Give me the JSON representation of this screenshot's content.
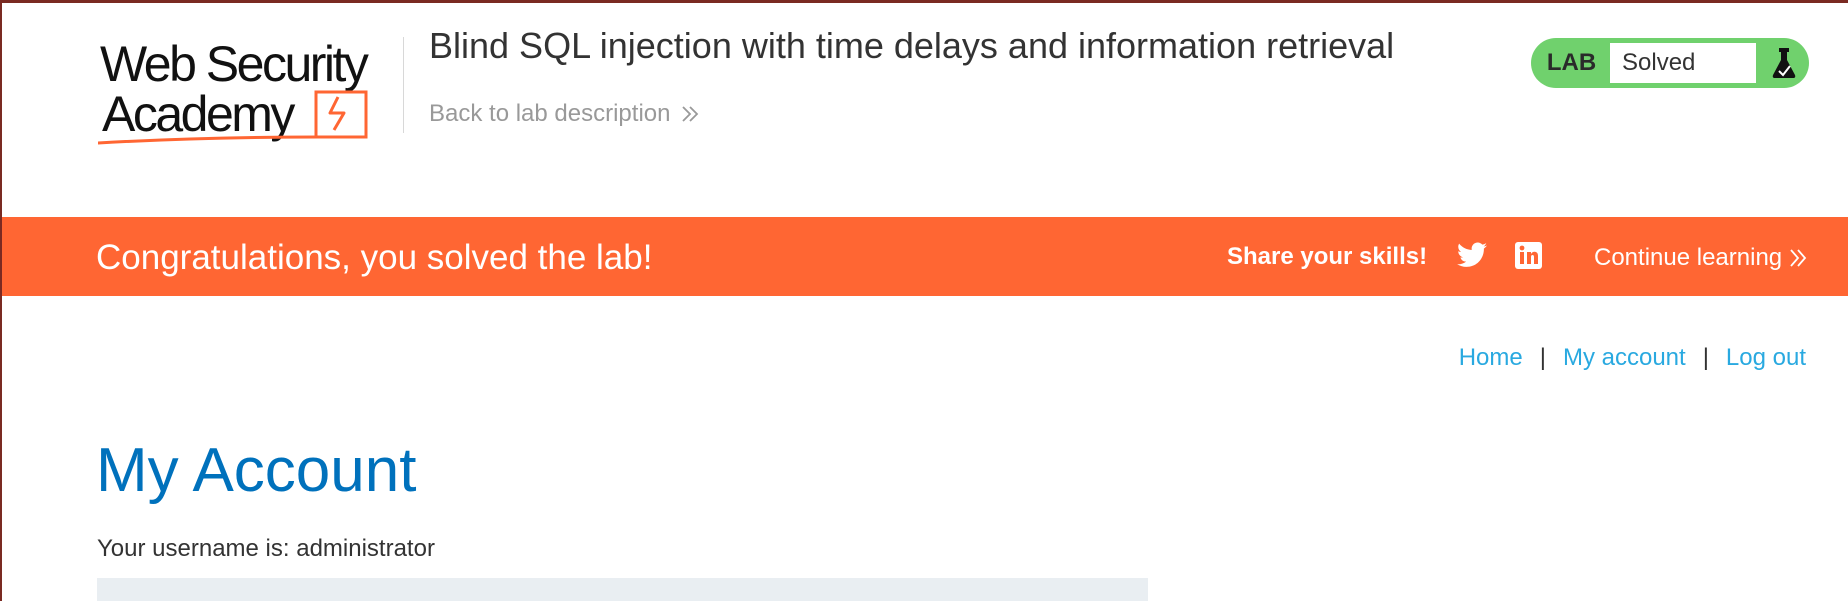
{
  "header": {
    "logo": {
      "line1": "Web Security",
      "line2": "Academy"
    },
    "lab_title": "Blind SQL injection with time delays and information retrieval",
    "back_link": "Back to lab description",
    "lab_status": {
      "label": "LAB",
      "status": "Solved",
      "icon": "flask-icon"
    }
  },
  "banner": {
    "message": "Congratulations, you solved the lab!",
    "share_label": "Share your skills!",
    "social_icons": [
      "twitter-icon",
      "linkedin-icon"
    ],
    "continue_label": "Continue learning"
  },
  "nav": {
    "home": "Home",
    "separator": "|",
    "my_account": "My account",
    "log_out": "Log out"
  },
  "main": {
    "heading": "My Account",
    "username_text": "Your username is: administrator"
  },
  "colors": {
    "brand_orange": "#ff6633",
    "lab_green": "#70d16d",
    "heading_blue": "#0071bc",
    "link_blue": "#29a9e0"
  }
}
